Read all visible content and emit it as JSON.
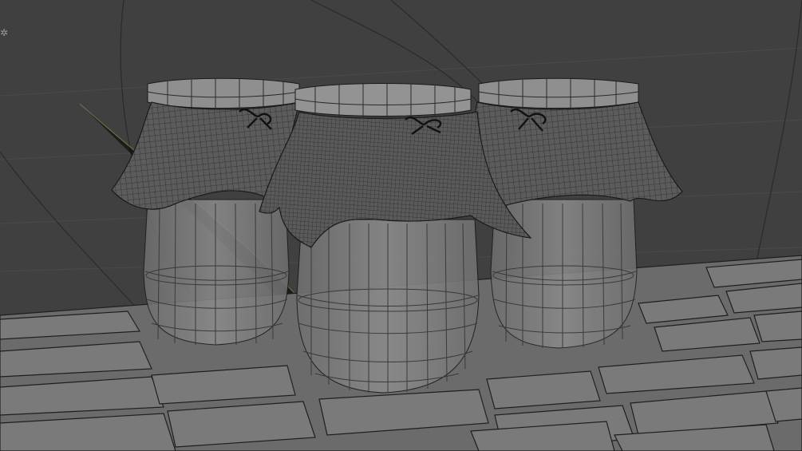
{
  "scene": {
    "description_shown": "",
    "background_color": "#404040",
    "wire_color": "#1a1a1a",
    "object_fill": "#8a8a8a",
    "cloth_fill": "#5a5a5a",
    "grid_color": "#4a4a4a",
    "x_axis_color": "#b4505a",
    "y_axis_color": "#a0a050",
    "objects": [
      "left-jar",
      "center-jar",
      "right-jar",
      "tile-floor"
    ]
  },
  "icons": {
    "light": "light-icon"
  }
}
